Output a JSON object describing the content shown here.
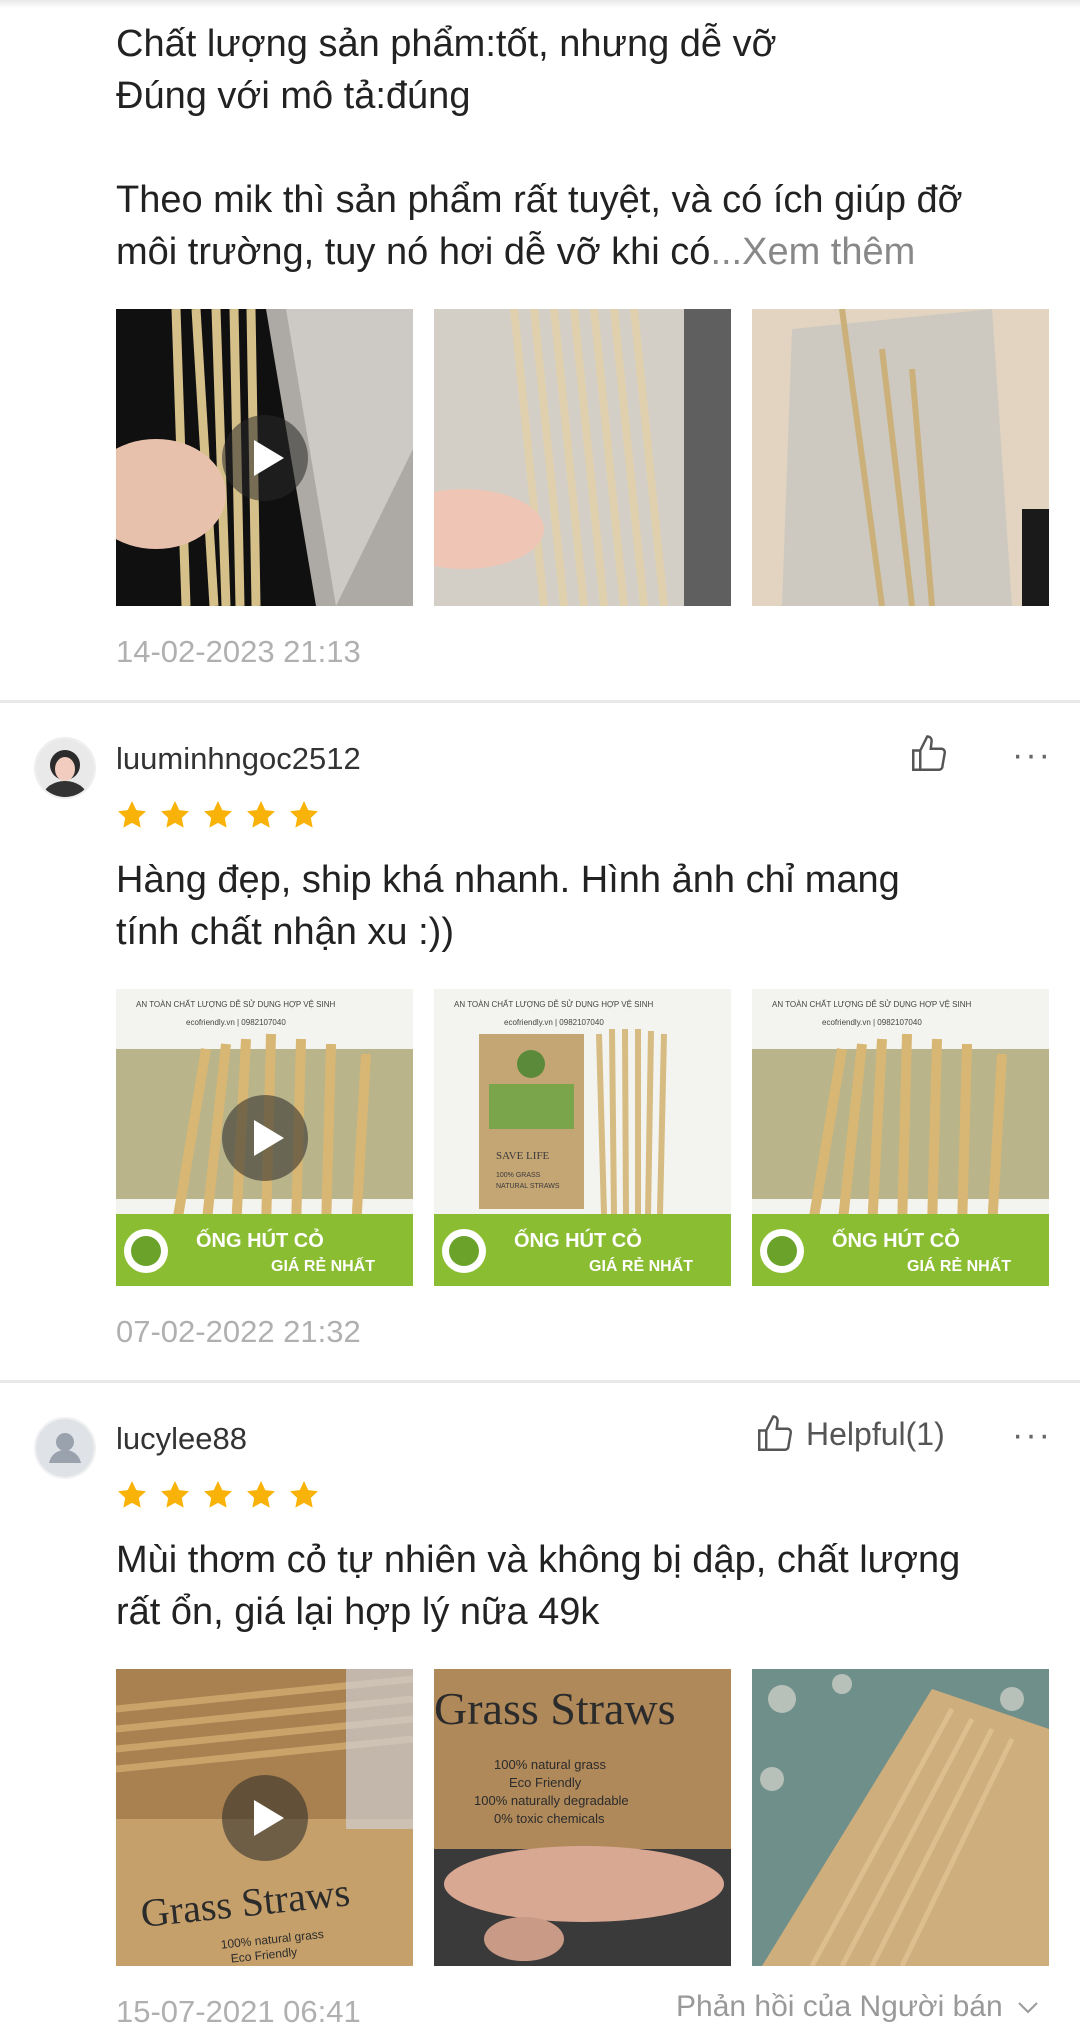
{
  "reviews": [
    {
      "id": "review-1",
      "text": "Chất lượng sản phẩm:tốt, nhưng dễ vỡ\nĐúng với mô tả:đúng\n\nTheo mik thì sản phẩm rất tuyệt, và có ích giúp đỡ\n môi trường, tuy nó hơi dễ vỡ khi có",
      "see_more": "...Xem thêm",
      "timestamp": "14-02-2023 21:13"
    },
    {
      "id": "review-2",
      "username": "luuminhngoc2512",
      "rating": 5,
      "text": "Hàng đẹp, ship khá nhanh. Hình ảnh chỉ mang\ntính chất nhận xu :))",
      "thumb_texts": {
        "banner_tags": "AN TOÀN   CHẤT LƯỢNG   DỄ SỬ DỤNG   HỢP VỆ SINH",
        "banner_contact": "ecofriendly.vn   |   0982107040",
        "product_title": "ỐNG HÚT CỎ",
        "product_sub": "GIÁ RẺ NHẤT",
        "box_line1": "SAVE LIFE",
        "box_line2": "100% GRASS",
        "box_line3": "NATURAL STRAWS"
      },
      "timestamp": "07-02-2022 21:32"
    },
    {
      "id": "review-3",
      "username": "lucylee88",
      "rating": 5,
      "helpful_label": "Helpful(1)",
      "text": "Mùi thơm cỏ tự nhiên và không bị dập, chất lượng\nrất ổn, giá lại hợp lý nữa 49k",
      "thumb_texts": {
        "brand": "Grass Straws",
        "line1": "100% natural grass",
        "line2": "Eco Friendly",
        "line3": "100% naturally degradable",
        "line4": "0% toxic chemicals"
      },
      "timestamp": "15-07-2021 06:41",
      "seller_reply_label": "Phản hồi của Người bán"
    }
  ],
  "more_label": "···",
  "colors": {
    "star": "#f9b208",
    "timestamp": "#b0b0b0",
    "see_more": "#888888"
  }
}
